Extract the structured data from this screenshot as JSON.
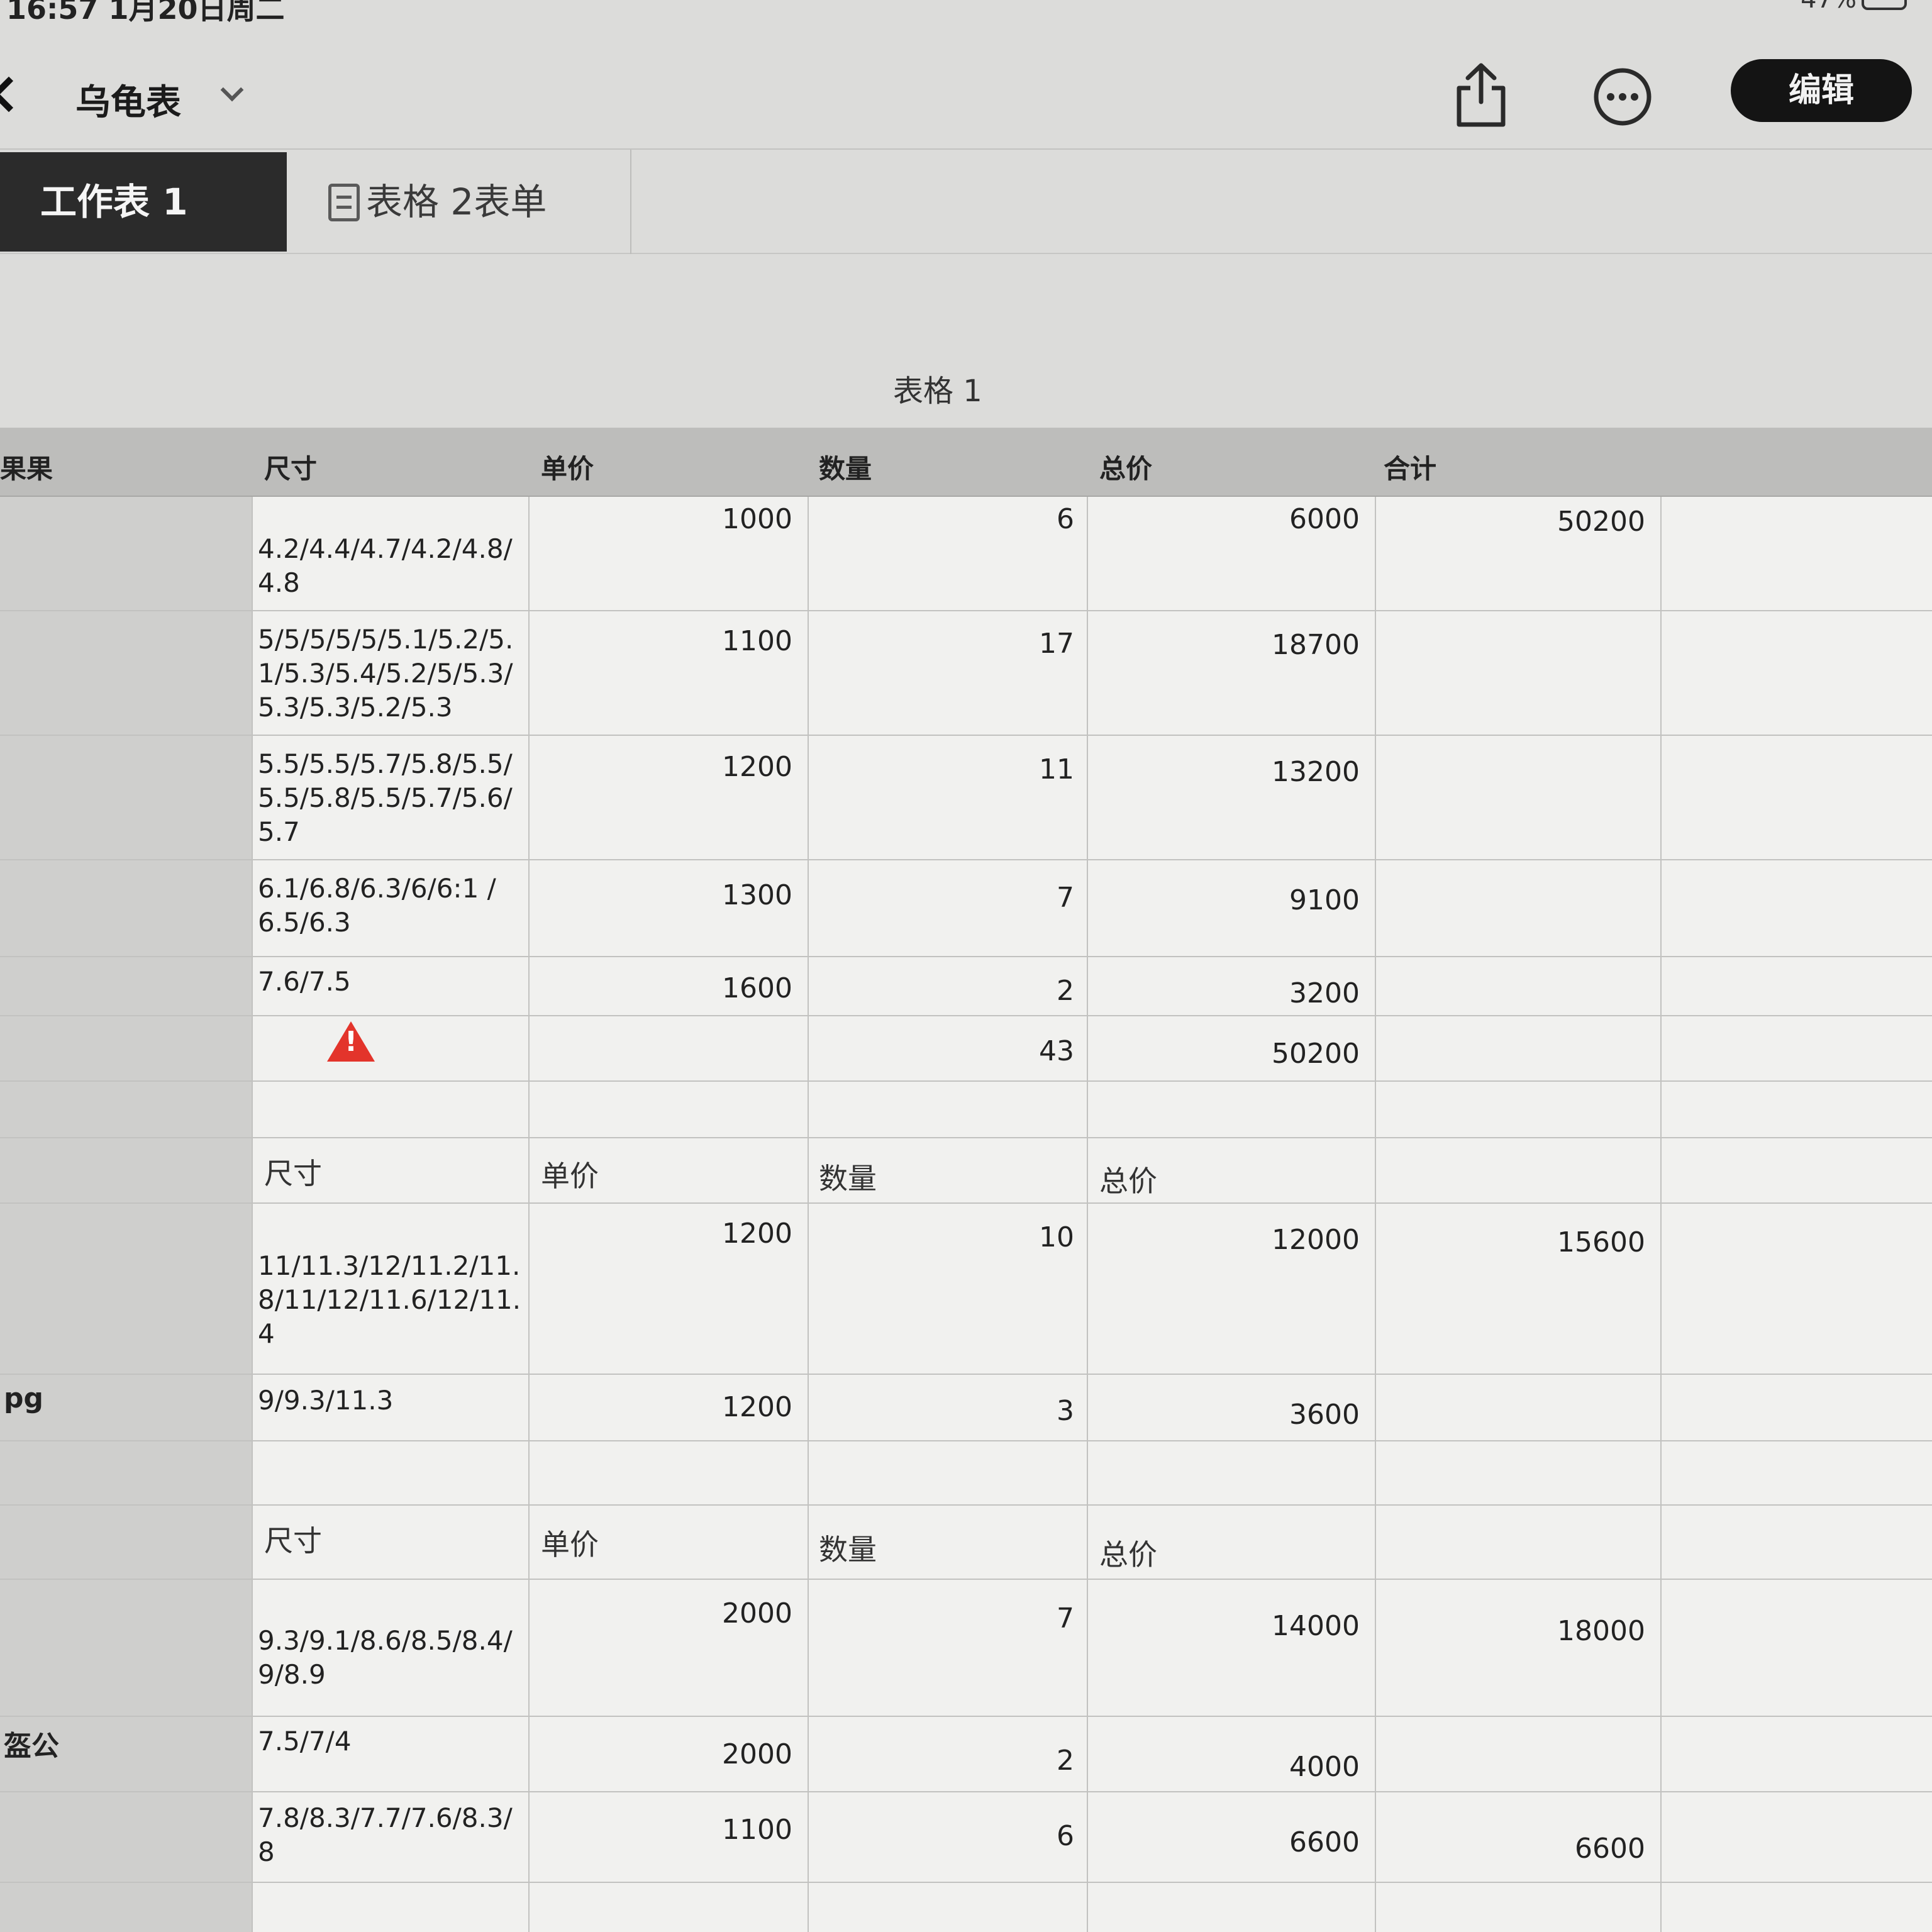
{
  "status_bar": {
    "time": "16:57  1月20日周二",
    "battery": "47%"
  },
  "nav": {
    "title": "乌龟表",
    "edit_label": "编辑"
  },
  "tabs": [
    {
      "label": "工作表 1"
    },
    {
      "label": "表格 2表单"
    }
  ],
  "sheet": {
    "title": "表格 1",
    "header": {
      "col0": "果果",
      "size": "尺寸",
      "unit_price": "单价",
      "quantity": "数量",
      "total_price": "总价",
      "sum": "合计"
    },
    "group1": {
      "rows": [
        {
          "size": "4.2/4.4/4.7/4.2/4.8/ 4.8",
          "price": "1000",
          "qty": "6",
          "total": "6000"
        },
        {
          "size": "5/5/5/5/5/5.1/5.2/5. 1/5.3/5.4/5.2/5/5.3/ 5.3/5.3/5.2/5.3",
          "price": "1100",
          "qty": "17",
          "total": "18700"
        },
        {
          "size": "5.5/5.5/5.7/5.8/5.5/ 5.5/5.8/5.5/5.7/5.6/ 5.7",
          "price": "1200",
          "qty": "11",
          "total": "13200"
        },
        {
          "size": "6.1/6.8/6.3/6/6:1 / 6.5/6.3",
          "price": "1300",
          "qty": "7",
          "total": "9100"
        },
        {
          "size": "7.6/7.5",
          "price": "1600",
          "qty": "2",
          "total": "3200"
        }
      ],
      "sum": "50200",
      "total_qty": "43",
      "total_price": "50200"
    },
    "group2": {
      "header": {
        "size": "尺寸",
        "unit_price": "单价",
        "quantity": "数量",
        "total_price": "总价"
      },
      "rows": [
        {
          "size": "11/11.3/12/11.2/11. 8/11/12/11.6/12/11. 4",
          "price": "1200",
          "qty": "10",
          "total": "12000"
        },
        {
          "label": "pg",
          "size": "9/9.3/11.3",
          "price": "1200",
          "qty": "3",
          "total": "3600"
        }
      ],
      "sum": "15600"
    },
    "group3": {
      "header": {
        "size": "尺寸",
        "unit_price": "单价",
        "quantity": "数量",
        "total_price": "总价"
      },
      "rows": [
        {
          "size": "9.3/9.1/8.6/8.5/8.4/ 9/8.9",
          "price": "2000",
          "qty": "7",
          "total": "14000"
        },
        {
          "label": "盔公",
          "size": "7.5/7/4",
          "price": "2000",
          "qty": "2",
          "total": "4000"
        },
        {
          "size": "7.8/8.3/7.7/7.6/8.3/ 8",
          "price": "1100",
          "qty": "6",
          "total": "6600"
        }
      ],
      "sum": "18000",
      "sum2": "6600"
    }
  },
  "colors": {
    "background": "#dcdcda",
    "header_band": "#bdbdbb",
    "cell": "#f1f1ef",
    "tab_active": "#2b2b2b",
    "warning": "#e3342b"
  },
  "icons": {
    "back": "chevron-left-icon",
    "title_chevron": "chevron-down-icon",
    "share": "share-icon",
    "more": "more-icon",
    "form": "form-icon",
    "warning": "warning-icon"
  }
}
